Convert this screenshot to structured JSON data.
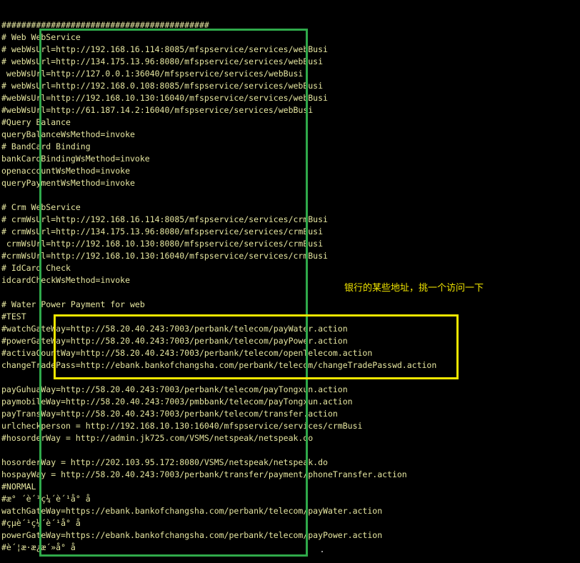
{
  "terminal": {
    "text_color": "#e6e6a0",
    "background": "#000000",
    "lines": [
      "##########################################",
      "# Web WebService",
      "# webWsUrl=http://192.168.16.114:8085/mfspservice/services/webBusi",
      "# webWsUrl=http://134.175.13.96:8080/mfspservice/services/webBusi",
      " webWsUrl=http://127.0.0.1:36040/mfspservice/services/webBusi",
      "# webWsUrl=http://192.168.0.108:8085/mfspservice/services/webBusi",
      "#webWsUrl=http://192.168.10.130:16040/mfspservice/services/webBusi",
      "#webWsUrl=http://61.187.14.2:16040/mfspservice/services/webBusi",
      "#Query Balance",
      "queryBalanceWsMethod=invoke",
      "# BandCard Binding",
      "bankCardBindingWsMethod=invoke",
      "openaccountWsMethod=invoke",
      "queryPaymentWsMethod=invoke",
      "",
      "# Crm WebService",
      "# crmWsUrl=http://192.168.16.114:8085/mfspservice/services/crmBusi",
      "# crmWsUrl=http://134.175.13.96:8080/mfspservice/services/crmBusi",
      " crmWsUrl=http://192.168.10.130:8080/mfspservice/services/crmBusi",
      "#crmWsUrl=http://192.168.10.130:16040/mfspservice/services/crmBusi",
      "# IdCard Check",
      "idcardCheckWsMethod=invoke",
      "",
      "# Water Power Payment for web",
      "#TEST",
      "#watchGateWay=http://58.20.40.243:7003/perbank/telecom/payWater.action",
      "#powerGateWay=http://58.20.40.243:7003/perbank/telecom/payPower.action",
      "#activaCountWay=http://58.20.40.243:7003/perbank/telecom/openTelecom.action",
      "changeTradePass=http://ebank.bankofchangsha.com/perbank/telecom/changeTradePasswd.action",
      "",
      "payGuhuaWay=http://58.20.40.243:7003/perbank/telecom/payTongxun.action",
      "paymobileWay=http://58.20.40.243:7003/pmbbank/telecom/payTongxun.action",
      "payTransWay=http://58.20.40.243:7003/perbank/telecom/transfer.action",
      "urlcheckperson = http://192.168.10.130:16040/mfspservice/services/crmBusi",
      "#hosorderWay = http://admin.jk725.com/VSMS/netspeak/netspeak.do",
      "",
      "hosorderWay = http://202.103.95.172:8080/VSMS/netspeak/netspeak.do",
      "hospayWay = http://58.20.40.243:7003/perbank/transfer/payment/phoneTransfer.action",
      "#NORMAL",
      "#æ° ´è´¹ç¼´è´¹å° å",
      "watchGateWay=https://ebank.bankofchangsha.com/perbank/telecom/payWater.action",
      "#çµè´¹ç¼´è´¹å° å",
      "powerGateWay=https://ebank.bankofchangsha.com/perbank/telecom/payPower.action",
      "#è´¦æ·æ¿æ´»å° å"
    ]
  },
  "annotation": {
    "text": "银行的某些地址，挑一个访问一下",
    "color": "#f2e600"
  },
  "highlights": {
    "green_color": "#2fa94a",
    "yellow_color": "#f2e600"
  }
}
